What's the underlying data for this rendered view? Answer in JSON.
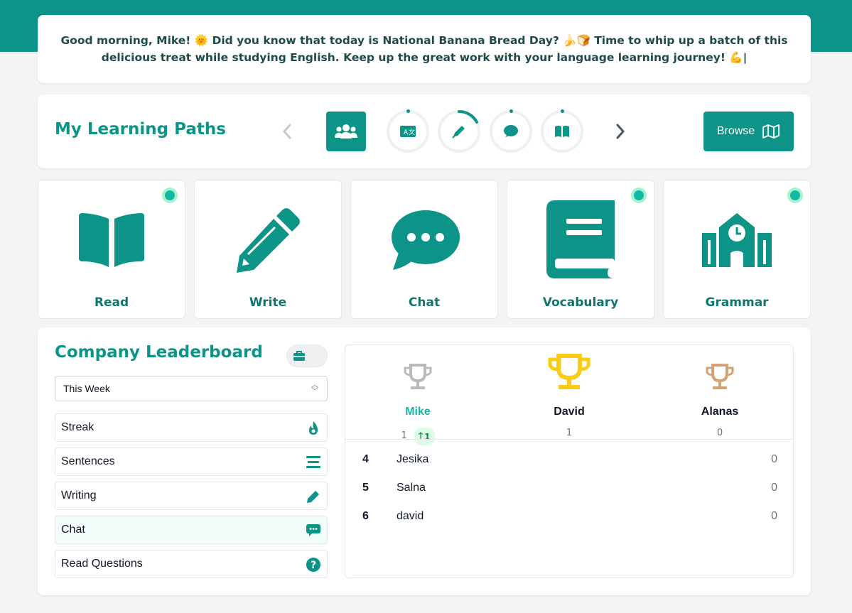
{
  "greeting": {
    "text": "Good morning, Mike! 🌞 Did you know that today is National Banana Bread Day? 🍌🍞 Time to whip up a batch of this delicious treat while studying English. Keep up the great work with your language learning journey! 💪|"
  },
  "paths": {
    "title": "My Learning Paths",
    "browse_label": "Browse",
    "icons": [
      "users-icon",
      "translate-icon",
      "pen-icon",
      "chat-bubble-icon",
      "book-open-icon"
    ],
    "prev_icon": "chevron-left-icon",
    "next_icon": "chevron-right-icon",
    "write_progress": 0.2
  },
  "skills": [
    {
      "label": "Read",
      "icon": "book-open-icon",
      "badge": true
    },
    {
      "label": "Write",
      "icon": "pencil-icon",
      "badge": false
    },
    {
      "label": "Chat",
      "icon": "speech-bubble-icon",
      "badge": false
    },
    {
      "label": "Vocabulary",
      "icon": "book-icon",
      "badge": true
    },
    {
      "label": "Grammar",
      "icon": "school-icon",
      "badge": true
    }
  ],
  "leaderboard": {
    "title": "Company Leaderboard",
    "period": "This Week",
    "categories": [
      {
        "label": "Streak",
        "icon": "fire-icon"
      },
      {
        "label": "Sentences",
        "icon": "lines-icon"
      },
      {
        "label": "Writing",
        "icon": "pencil-icon"
      },
      {
        "label": "Chat",
        "icon": "chat-dots-icon"
      },
      {
        "label": "Read Questions",
        "icon": "question-icon"
      }
    ],
    "podium": [
      {
        "name": "Mike",
        "score": "1",
        "change": "1",
        "trophy_color": "#b9b9b9",
        "name_color": "#14b8a6"
      },
      {
        "name": "David",
        "score": "1",
        "trophy_color": "#facc15",
        "name_color": "#111827"
      },
      {
        "name": "Alanas",
        "score": "0",
        "trophy_color": "#d4a373",
        "name_color": "#111827"
      }
    ],
    "rows": [
      {
        "rank": "4",
        "name": "Jesika",
        "points": "0"
      },
      {
        "rank": "5",
        "name": "Salna",
        "points": "0"
      },
      {
        "rank": "6",
        "name": "david",
        "points": "0"
      }
    ]
  },
  "colors": {
    "brand": "#0d9488",
    "active_dot": "#14b8a6"
  }
}
